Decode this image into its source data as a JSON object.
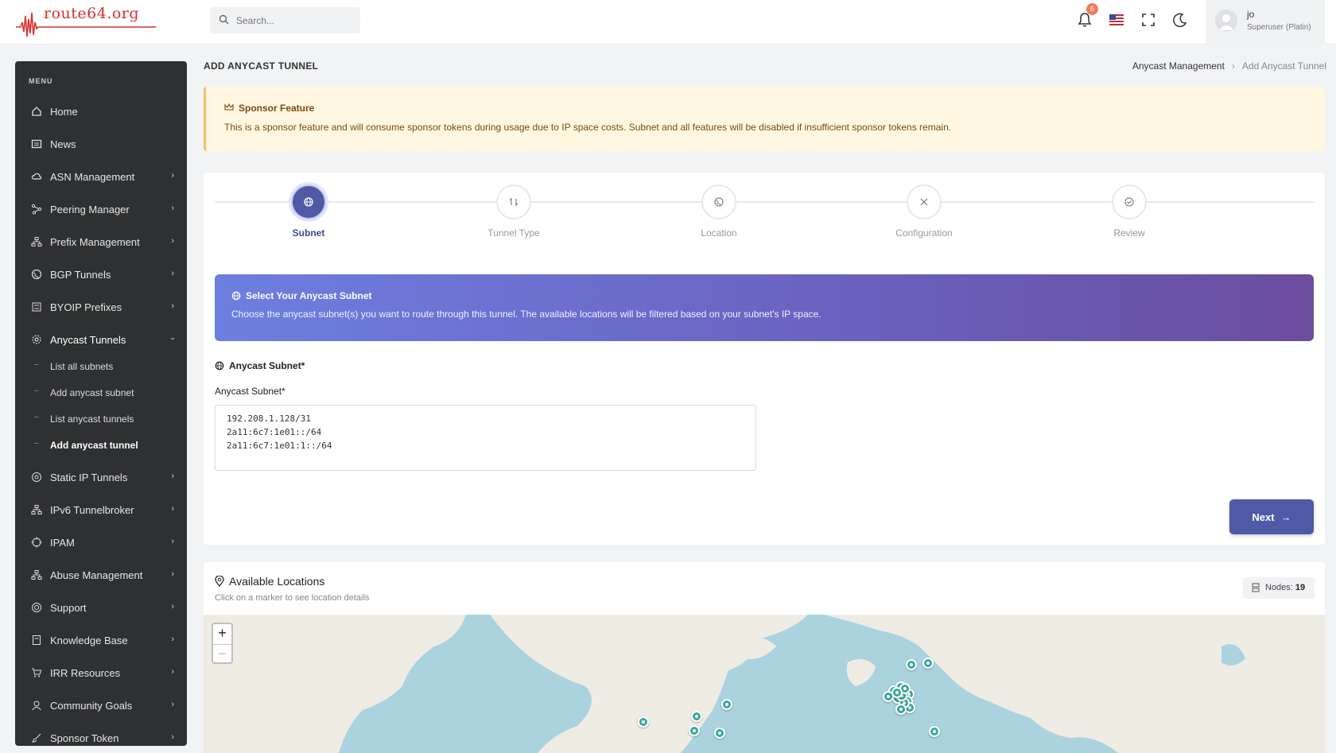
{
  "app": {
    "logo_text": "route64.org",
    "search_placeholder": "Search...",
    "notification_count": "6",
    "user_name": "jo",
    "user_role": "Superuser (Platin)"
  },
  "sidebar": {
    "menu_title": "MENU",
    "items": [
      {
        "label": "Home",
        "icon": "home-icon"
      },
      {
        "label": "News",
        "icon": "newspaper-icon"
      },
      {
        "label": "ASN Management",
        "icon": "cloud-icon"
      },
      {
        "label": "Peering Manager",
        "icon": "share-icon"
      },
      {
        "label": "Prefix Management",
        "icon": "sitemap-icon"
      },
      {
        "label": "BGP Tunnels",
        "icon": "globe-icon"
      },
      {
        "label": "BYOIP Prefixes",
        "icon": "server-icon"
      },
      {
        "label": "Anycast Tunnels",
        "icon": "broadcast-icon"
      },
      {
        "label": "Static IP Tunnels",
        "icon": "network-icon"
      },
      {
        "label": "IPv6 Tunnelbroker",
        "icon": "sitemap-icon"
      },
      {
        "label": "IPAM",
        "icon": "target-icon"
      },
      {
        "label": "Abuse Management",
        "icon": "sitemap-icon"
      },
      {
        "label": "Support",
        "icon": "lifebuoy-icon"
      },
      {
        "label": "Knowledge Base",
        "icon": "book-icon"
      },
      {
        "label": "IRR Resources",
        "icon": "cart-icon"
      },
      {
        "label": "Community Goals",
        "icon": "users-icon"
      },
      {
        "label": "Sponsor Token",
        "icon": "brush-icon"
      }
    ],
    "anycast_sub": [
      {
        "label": "List all subnets"
      },
      {
        "label": "Add anycast subnet"
      },
      {
        "label": "List anycast tunnels"
      },
      {
        "label": "Add anycast tunnel"
      }
    ]
  },
  "header": {
    "title": "ADD ANYCAST TUNNEL",
    "breadcrumb": [
      "Anycast Management",
      "Add Anycast Tunnel"
    ]
  },
  "alert": {
    "title": "Sponsor Feature",
    "text": "This is a sponsor feature and will consume sponsor tokens during usage due to IP space costs. Subnet and all features will be disabled if insufficient sponsor tokens remain."
  },
  "stepper": {
    "steps": [
      {
        "label": "Subnet",
        "active": true
      },
      {
        "label": "Tunnel Type",
        "active": false
      },
      {
        "label": "Location",
        "active": false
      },
      {
        "label": "Configuration",
        "active": false
      },
      {
        "label": "Review",
        "active": false
      }
    ]
  },
  "hero": {
    "title": "Select Your Anycast Subnet",
    "text": "Choose the anycast subnet(s) you want to route through this tunnel. The available locations will be filtered based on your subnet's IP space."
  },
  "form": {
    "group_title": "Anycast Subnet*",
    "field_label": "Anycast Subnet*",
    "subnets": [
      "192.208.1.128/31",
      "2a11:6c7:1e01::/64",
      "2a11:6c7:1e01:1::/64"
    ],
    "next_label": "Next"
  },
  "locations": {
    "title": "Available Locations",
    "subtitle": "Click on a marker to see location details",
    "nodes_label": "Nodes:",
    "nodes_count": "19",
    "zoom_in": "+",
    "zoom_out": "−"
  },
  "colors": {
    "accent": "#4e5aa6",
    "sidebar_bg": "#2f3032",
    "alert_bg": "#fff7df",
    "marker": "#3aa89e",
    "logo": "#d93030"
  }
}
